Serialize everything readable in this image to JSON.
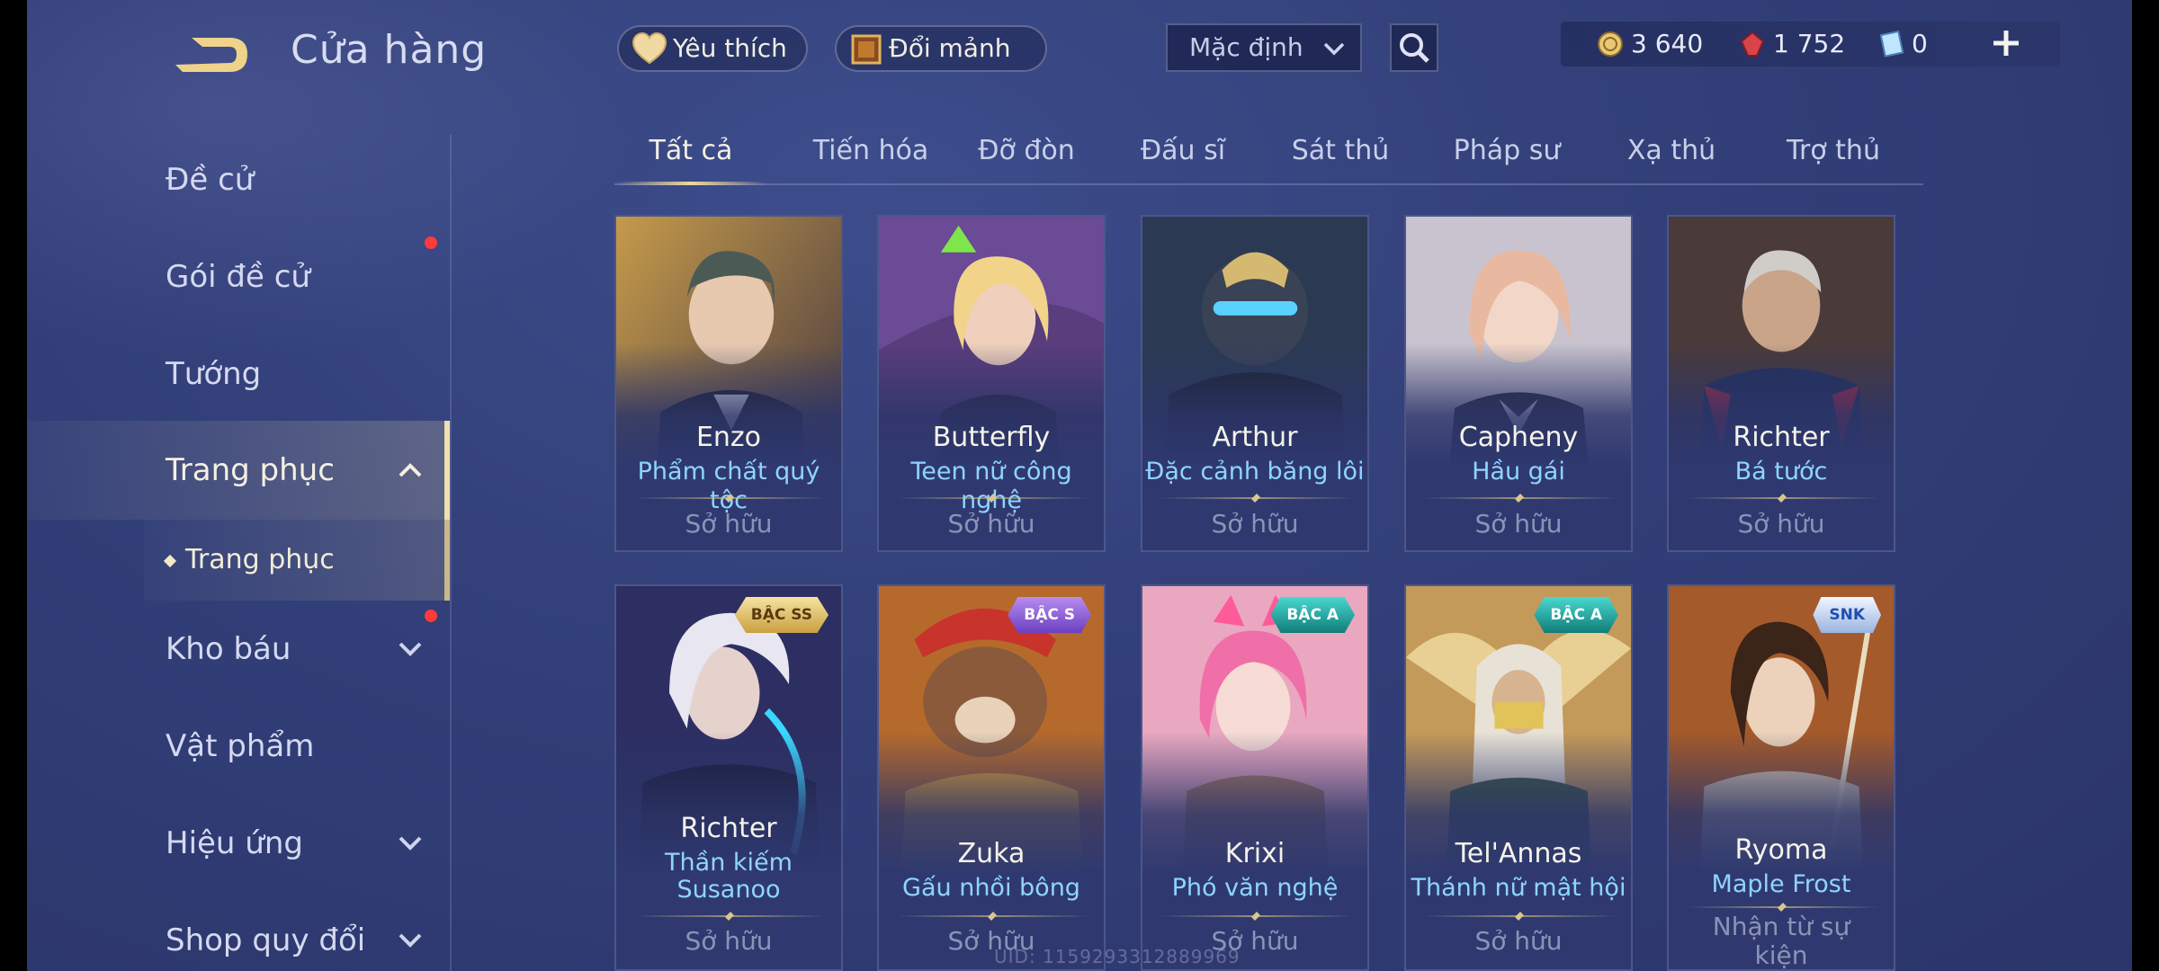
{
  "header": {
    "title": "Cửa hàng"
  },
  "sidebar": {
    "items": [
      {
        "label": "Đề cử"
      },
      {
        "label": "Gói đề cử"
      },
      {
        "label": "Tướng"
      },
      {
        "label": "Trang phục"
      },
      {
        "label": "Kho báu"
      },
      {
        "label": "Vật phẩm"
      },
      {
        "label": "Hiệu ứng"
      },
      {
        "label": "Shop quy đổi"
      }
    ],
    "sub_item": {
      "label": "Trang phục"
    }
  },
  "topbar": {
    "favorites_label": "Yêu thích",
    "exchange_label": "Đổi mảnh",
    "sort_value": "Mặc định",
    "currencies": [
      {
        "icon": "gold-coin-icon",
        "value": "3 640"
      },
      {
        "icon": "red-gem-icon",
        "value": "1 752"
      },
      {
        "icon": "voucher-icon",
        "value": "0"
      }
    ]
  },
  "tabs": [
    {
      "label": "Tất cả",
      "active": true
    },
    {
      "label": "Tiến hóa"
    },
    {
      "label": "Đỡ đòn"
    },
    {
      "label": "Đấu sĩ"
    },
    {
      "label": "Sát thủ"
    },
    {
      "label": "Pháp sư"
    },
    {
      "label": "Xạ thủ"
    },
    {
      "label": "Trợ thủ"
    }
  ],
  "cards": [
    {
      "hero": "Enzo",
      "skin": "Phẩm chất quý tộc",
      "status": "Sở hữu"
    },
    {
      "hero": "Butterfly",
      "skin": "Teen nữ công nghệ",
      "status": "Sở hữu"
    },
    {
      "hero": "Arthur",
      "skin": "Đặc cảnh băng lôi",
      "status": "Sở hữu"
    },
    {
      "hero": "Capheny",
      "skin": "Hầu gái",
      "status": "Sở hữu"
    },
    {
      "hero": "Richter",
      "skin": "Bá tước",
      "status": "Sở hữu"
    },
    {
      "hero": "Richter",
      "skin": "Thần kiếm",
      "skin2": "Susanoo",
      "status": "Sở hữu",
      "badge": "BẬC SS"
    },
    {
      "hero": "Zuka",
      "skin": "Gấu nhồi bông",
      "status": "Sở hữu",
      "badge": "BẬC S"
    },
    {
      "hero": "Krixi",
      "skin": "Phó văn nghệ",
      "status": "Sở hữu",
      "badge": "BẬC A"
    },
    {
      "hero": "Tel'Annas",
      "skin": "Thánh nữ mật hội",
      "status": "Sở hữu",
      "badge": "BẬC A"
    },
    {
      "hero": "Ryoma",
      "skin": "Maple Frost",
      "status": "Nhận từ sự",
      "status2": "kiện",
      "badge": "SNK"
    }
  ],
  "footer": {
    "uid": "UID: 1159293312889969"
  },
  "colors": {
    "accent": "#f0d99a",
    "skin_text": "#8fd4ff",
    "badge_ss": "#e2c46a",
    "badge_s": "#8a5bd6",
    "badge_a": "#1ea8a4"
  }
}
